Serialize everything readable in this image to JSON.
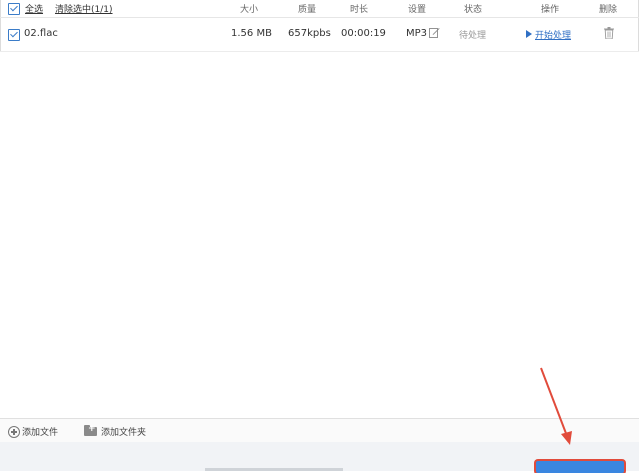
{
  "header": {
    "select_all": "全选",
    "clear_selected": "清除选中(1/1)",
    "col_size": "大小",
    "col_quality": "质量",
    "col_duration": "时长",
    "col_settings": "设置",
    "col_status": "状态",
    "col_action": "操作",
    "col_delete": "删除"
  },
  "files": [
    {
      "name": "02.flac",
      "size": "1.56 MB",
      "quality": "657kpbs",
      "duration": "00:00:19",
      "format": "MP3",
      "status": "待处理",
      "action": "开始处理"
    }
  ],
  "toolbar": {
    "add_file": "添加文件",
    "add_folder": "添加文件夹"
  },
  "colors": {
    "accent": "#3a86e0",
    "highlight": "#e14b3b",
    "checkbox": "#3b7cc8"
  },
  "icons": [
    "checkbox-icon",
    "edit-icon",
    "play-icon",
    "trash-icon",
    "plus-circle-icon",
    "folder-add-icon"
  ]
}
